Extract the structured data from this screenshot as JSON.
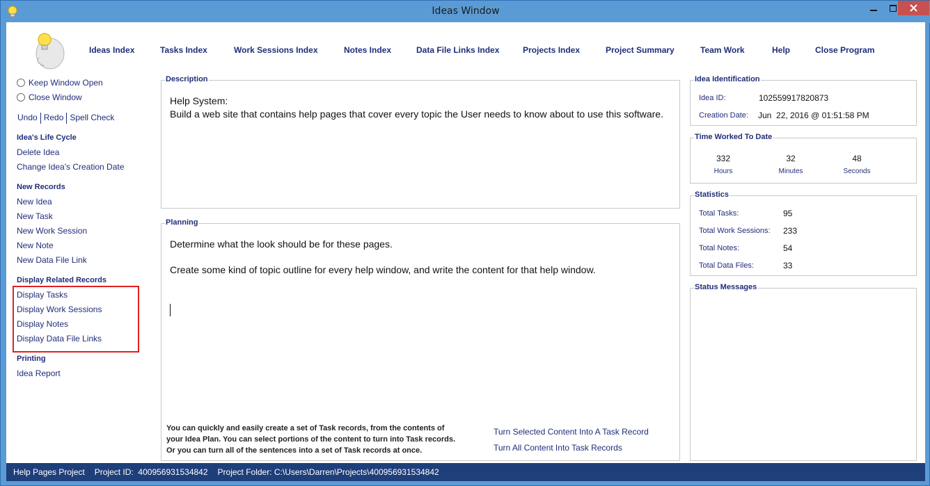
{
  "window": {
    "title": "Ideas Window",
    "min_symbol": "▁",
    "max_symbol": "□",
    "close_symbol": "✕"
  },
  "topnav": [
    {
      "name": "nav-ideas-index",
      "label": "Ideas Index"
    },
    {
      "name": "nav-tasks-index",
      "label": "Tasks Index"
    },
    {
      "name": "nav-work-sessions-index",
      "label": "Work Sessions Index"
    },
    {
      "name": "nav-notes-index",
      "label": "Notes Index"
    },
    {
      "name": "nav-data-file-links-index",
      "label": "Data File Links Index"
    },
    {
      "name": "nav-projects-index",
      "label": "Projects Index"
    },
    {
      "name": "nav-project-summary",
      "label": "Project Summary"
    },
    {
      "name": "nav-team-work",
      "label": "Team Work"
    },
    {
      "name": "nav-help",
      "label": "Help"
    },
    {
      "name": "nav-close-program",
      "label": "Close Program"
    }
  ],
  "left": {
    "keep_window_open": "Keep Window Open",
    "close_window": "Close Window",
    "undo": "Undo",
    "redo": "Redo",
    "spell_check": "Spell Check",
    "life_cycle_head": "Idea's Life Cycle",
    "delete_idea": "Delete Idea",
    "change_creation_date": "Change Idea's Creation Date",
    "new_records_head": "New Records",
    "new_idea": "New Idea",
    "new_task": "New Task",
    "new_work_session": "New Work Session",
    "new_note": "New Note",
    "new_data_file_link": "New Data File Link",
    "display_related_head": "Display Related Records",
    "display_tasks": "Display Tasks",
    "display_work_sessions": "Display Work Sessions",
    "display_notes": "Display Notes",
    "display_data_file_links": "Display Data File Links",
    "printing_head": "Printing",
    "idea_report": "Idea Report"
  },
  "description": {
    "title": "Description",
    "line1": "Help System:",
    "line2": "Build a web site that contains help pages that cover every topic the User needs to know about to use this software."
  },
  "planning": {
    "title": "Planning",
    "line1": "Determine what the look should be for these pages.",
    "line2": "Create some kind of topic outline for every help window, and write the content for that help window.",
    "help1": "You can quickly and easily create a set of Task records, from the contents of",
    "help2": "your Idea Plan. You can select portions of the content to turn into Task records.",
    "help3": "Or you can turn all of the sentences into a set of Task records at once.",
    "link_selected": "Turn Selected Content Into A Task Record",
    "link_all": "Turn All Content Into Task Records"
  },
  "identification": {
    "title": "Idea Identification",
    "id_label": "Idea ID:",
    "id_value": "102559917820873",
    "date_label": "Creation Date:",
    "date_value": "Jun  22, 2016 @ 01:51:58 PM"
  },
  "time_worked": {
    "title": "Time Worked To Date",
    "hours": "332",
    "hours_label": "Hours",
    "minutes": "32",
    "minutes_label": "Minutes",
    "seconds": "48",
    "seconds_label": "Seconds"
  },
  "statistics": {
    "title": "Statistics",
    "tasks_label": "Total Tasks:",
    "tasks": "95",
    "sessions_label": "Total Work Sessions:",
    "sessions": "233",
    "notes_label": "Total Notes:",
    "notes": "54",
    "files_label": "Total Data Files:",
    "files": "33"
  },
  "status_messages": {
    "title": "Status Messages"
  },
  "statusbar": {
    "project": "Help Pages Project",
    "project_id": "Project ID:  400956931534842",
    "folder": "Project Folder: C:\\Users\\Darren\\Projects\\400956931534842"
  }
}
